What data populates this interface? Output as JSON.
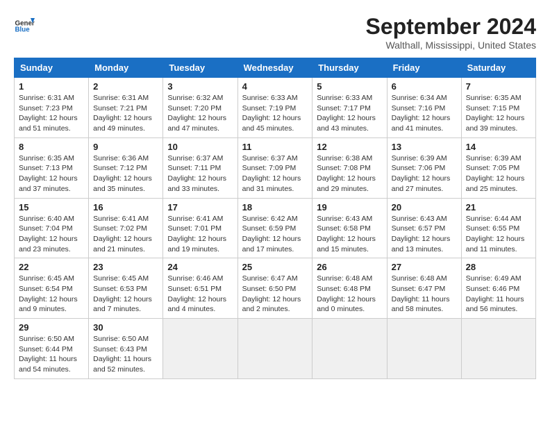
{
  "header": {
    "title": "September 2024",
    "location": "Walthall, Mississippi, United States",
    "logo_line1": "General",
    "logo_line2": "Blue"
  },
  "columns": [
    "Sunday",
    "Monday",
    "Tuesday",
    "Wednesday",
    "Thursday",
    "Friday",
    "Saturday"
  ],
  "weeks": [
    [
      {
        "day": "1",
        "sunrise": "6:31 AM",
        "sunset": "7:23 PM",
        "daylight": "12 hours and 51 minutes."
      },
      {
        "day": "2",
        "sunrise": "6:31 AM",
        "sunset": "7:21 PM",
        "daylight": "12 hours and 49 minutes."
      },
      {
        "day": "3",
        "sunrise": "6:32 AM",
        "sunset": "7:20 PM",
        "daylight": "12 hours and 47 minutes."
      },
      {
        "day": "4",
        "sunrise": "6:33 AM",
        "sunset": "7:19 PM",
        "daylight": "12 hours and 45 minutes."
      },
      {
        "day": "5",
        "sunrise": "6:33 AM",
        "sunset": "7:17 PM",
        "daylight": "12 hours and 43 minutes."
      },
      {
        "day": "6",
        "sunrise": "6:34 AM",
        "sunset": "7:16 PM",
        "daylight": "12 hours and 41 minutes."
      },
      {
        "day": "7",
        "sunrise": "6:35 AM",
        "sunset": "7:15 PM",
        "daylight": "12 hours and 39 minutes."
      }
    ],
    [
      {
        "day": "8",
        "sunrise": "6:35 AM",
        "sunset": "7:13 PM",
        "daylight": "12 hours and 37 minutes."
      },
      {
        "day": "9",
        "sunrise": "6:36 AM",
        "sunset": "7:12 PM",
        "daylight": "12 hours and 35 minutes."
      },
      {
        "day": "10",
        "sunrise": "6:37 AM",
        "sunset": "7:11 PM",
        "daylight": "12 hours and 33 minutes."
      },
      {
        "day": "11",
        "sunrise": "6:37 AM",
        "sunset": "7:09 PM",
        "daylight": "12 hours and 31 minutes."
      },
      {
        "day": "12",
        "sunrise": "6:38 AM",
        "sunset": "7:08 PM",
        "daylight": "12 hours and 29 minutes."
      },
      {
        "day": "13",
        "sunrise": "6:39 AM",
        "sunset": "7:06 PM",
        "daylight": "12 hours and 27 minutes."
      },
      {
        "day": "14",
        "sunrise": "6:39 AM",
        "sunset": "7:05 PM",
        "daylight": "12 hours and 25 minutes."
      }
    ],
    [
      {
        "day": "15",
        "sunrise": "6:40 AM",
        "sunset": "7:04 PM",
        "daylight": "12 hours and 23 minutes."
      },
      {
        "day": "16",
        "sunrise": "6:41 AM",
        "sunset": "7:02 PM",
        "daylight": "12 hours and 21 minutes."
      },
      {
        "day": "17",
        "sunrise": "6:41 AM",
        "sunset": "7:01 PM",
        "daylight": "12 hours and 19 minutes."
      },
      {
        "day": "18",
        "sunrise": "6:42 AM",
        "sunset": "6:59 PM",
        "daylight": "12 hours and 17 minutes."
      },
      {
        "day": "19",
        "sunrise": "6:43 AM",
        "sunset": "6:58 PM",
        "daylight": "12 hours and 15 minutes."
      },
      {
        "day": "20",
        "sunrise": "6:43 AM",
        "sunset": "6:57 PM",
        "daylight": "12 hours and 13 minutes."
      },
      {
        "day": "21",
        "sunrise": "6:44 AM",
        "sunset": "6:55 PM",
        "daylight": "12 hours and 11 minutes."
      }
    ],
    [
      {
        "day": "22",
        "sunrise": "6:45 AM",
        "sunset": "6:54 PM",
        "daylight": "12 hours and 9 minutes."
      },
      {
        "day": "23",
        "sunrise": "6:45 AM",
        "sunset": "6:53 PM",
        "daylight": "12 hours and 7 minutes."
      },
      {
        "day": "24",
        "sunrise": "6:46 AM",
        "sunset": "6:51 PM",
        "daylight": "12 hours and 4 minutes."
      },
      {
        "day": "25",
        "sunrise": "6:47 AM",
        "sunset": "6:50 PM",
        "daylight": "12 hours and 2 minutes."
      },
      {
        "day": "26",
        "sunrise": "6:48 AM",
        "sunset": "6:48 PM",
        "daylight": "12 hours and 0 minutes."
      },
      {
        "day": "27",
        "sunrise": "6:48 AM",
        "sunset": "6:47 PM",
        "daylight": "11 hours and 58 minutes."
      },
      {
        "day": "28",
        "sunrise": "6:49 AM",
        "sunset": "6:46 PM",
        "daylight": "11 hours and 56 minutes."
      }
    ],
    [
      {
        "day": "29",
        "sunrise": "6:50 AM",
        "sunset": "6:44 PM",
        "daylight": "11 hours and 54 minutes."
      },
      {
        "day": "30",
        "sunrise": "6:50 AM",
        "sunset": "6:43 PM",
        "daylight": "11 hours and 52 minutes."
      },
      null,
      null,
      null,
      null,
      null
    ]
  ]
}
